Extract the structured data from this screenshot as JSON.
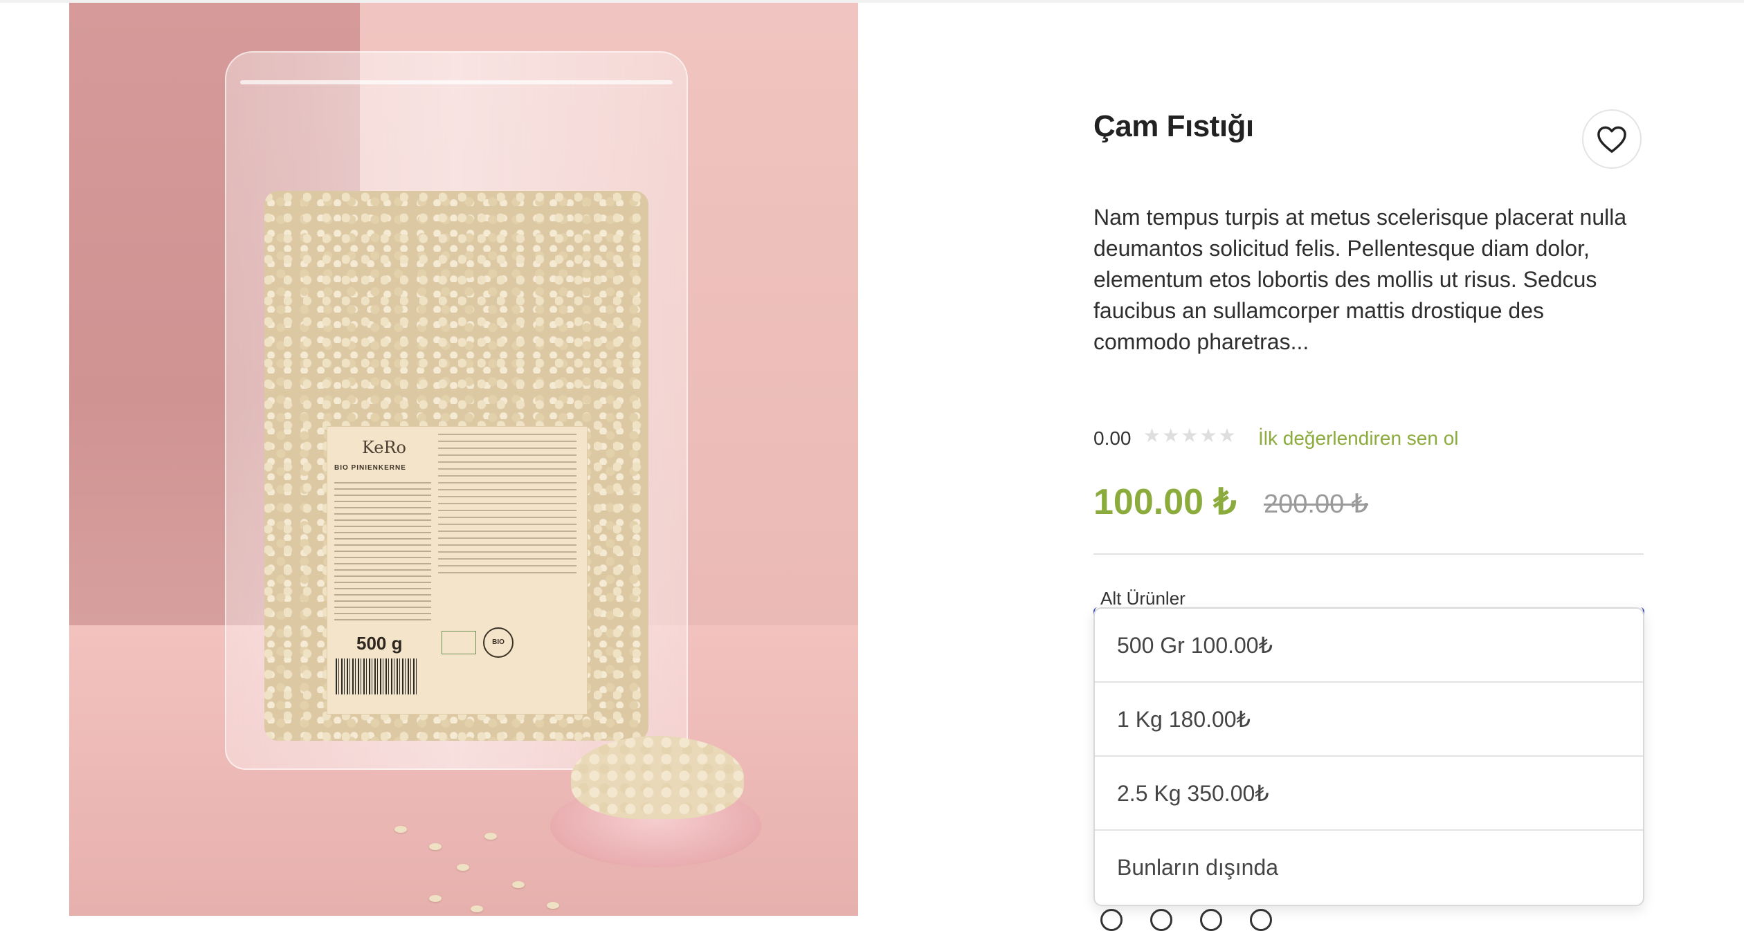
{
  "product": {
    "title": "Çam Fıstığı",
    "description": "Nam tempus turpis at metus scelerisque placerat nulla deumantos solicitud felis. Pellentesque diam dolor, elementum etos lobortis des mollis ut risus. Sedcus faucibus an sullamcorper mattis drostique des commodo pharetras...",
    "rating_value": "0.00",
    "rating_stars_filled": 0,
    "rating_stars_total": 5,
    "review_link": "İlk değerlendiren sen ol",
    "price_current": "100.00 ₺",
    "price_old": "200.00 ₺"
  },
  "image": {
    "brand": "KeRo",
    "product_label": "BIO PINIENKERNE",
    "weight": "500 g",
    "bio": "BIO"
  },
  "variants": {
    "label": "Alt Ürünler",
    "selected": "500 Gr 100.00₺",
    "options": [
      "500 Gr 100.00₺",
      "1 Kg 180.00₺",
      "2.5 Kg 350.00₺",
      "Bunların dışında"
    ]
  },
  "colors": {
    "accent_green": "#8cab3d",
    "focus_blue": "#3f51b5",
    "old_price_gray": "#9a9a9a"
  },
  "icons": {
    "favorite": "heart-outline-icon",
    "rating": "star-icon"
  }
}
